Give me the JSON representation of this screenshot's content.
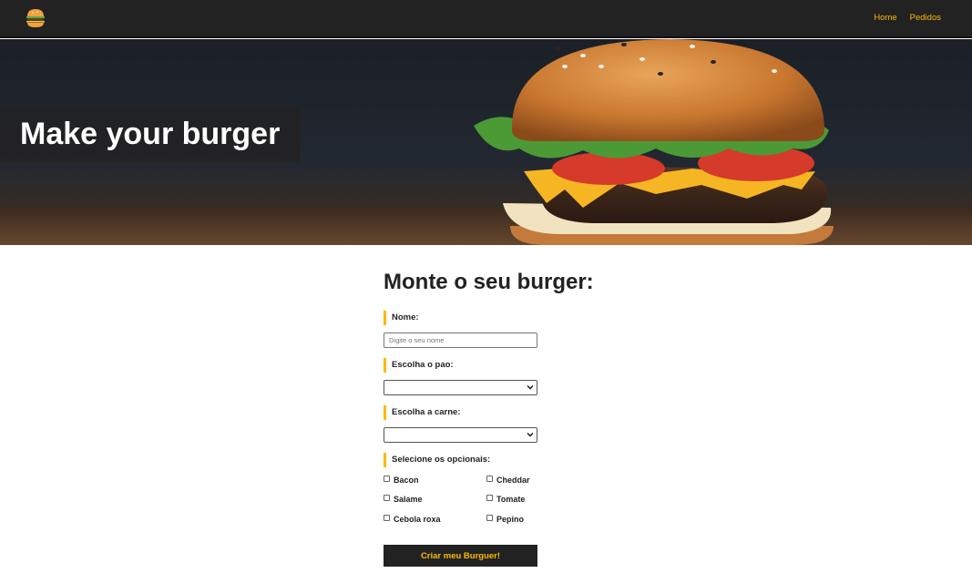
{
  "navbar": {
    "logo_icon": "burger-logo-icon",
    "links": [
      {
        "label": "Home"
      },
      {
        "label": "Pedidos"
      }
    ],
    "link_color": "#fcba03",
    "background": "#222222"
  },
  "hero": {
    "title": "Make your burger",
    "image_icon": "burger-photo"
  },
  "form": {
    "heading": "Monte o seu burger:",
    "name_label": "Nome:",
    "name_placeholder": "Digite o seu nome",
    "name_value": "",
    "bread_label": "Escolha o pao:",
    "bread_selected": "",
    "meat_label": "Escolha a carne:",
    "meat_selected": "",
    "optionals_label": "Selecione os opcionais:",
    "optionals": [
      {
        "label": "Bacon",
        "checked": false
      },
      {
        "label": "Cheddar",
        "checked": false
      },
      {
        "label": "Salame",
        "checked": false
      },
      {
        "label": "Tomate",
        "checked": false
      },
      {
        "label": "Cebola roxa",
        "checked": false
      },
      {
        "label": "Pepino",
        "checked": false
      }
    ],
    "submit_label": "Criar meu Burguer!",
    "accent_color": "#fcba03"
  }
}
